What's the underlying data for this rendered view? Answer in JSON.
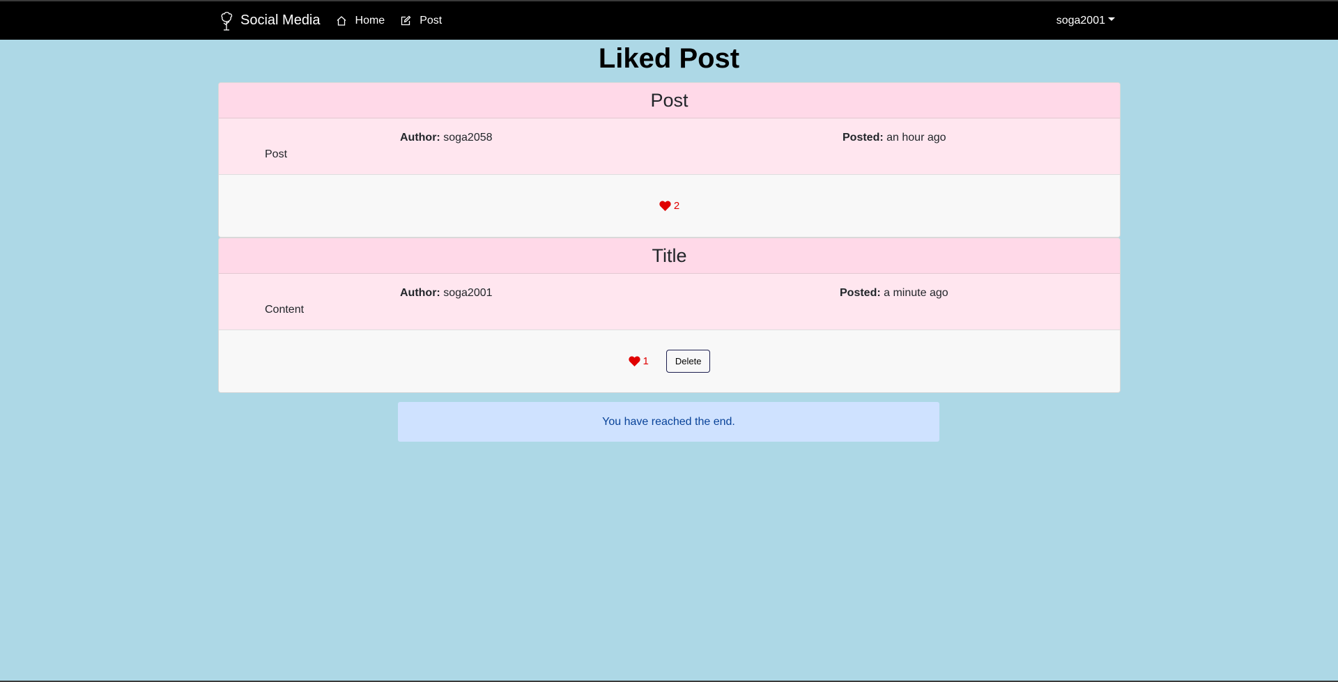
{
  "nav": {
    "brand": "Social Media",
    "brand_icon": "tree-icon",
    "links": [
      {
        "label": "Home",
        "icon": "home-icon"
      },
      {
        "label": "Post",
        "icon": "edit-icon"
      }
    ],
    "user": "soga2001"
  },
  "page": {
    "title": "Liked Post"
  },
  "labels": {
    "author": "Author:",
    "posted": "Posted:"
  },
  "posts": [
    {
      "title": "Post",
      "author": "soga2058",
      "posted": "an hour ago",
      "content": "Post",
      "likes": "2"
    },
    {
      "title": "Title",
      "author": "soga2001",
      "posted": "a minute ago",
      "content": "Content",
      "likes": "1",
      "delete_label": "Delete"
    }
  ],
  "end_message": "You have reached the end.",
  "colors": {
    "background": "#add8e6",
    "navbar": "#000000",
    "card_header": "#ffd9e8",
    "card_body": "#ffe6ef",
    "like": "#e00000",
    "alert_bg": "#cfe2ff",
    "alert_text": "#084298"
  }
}
